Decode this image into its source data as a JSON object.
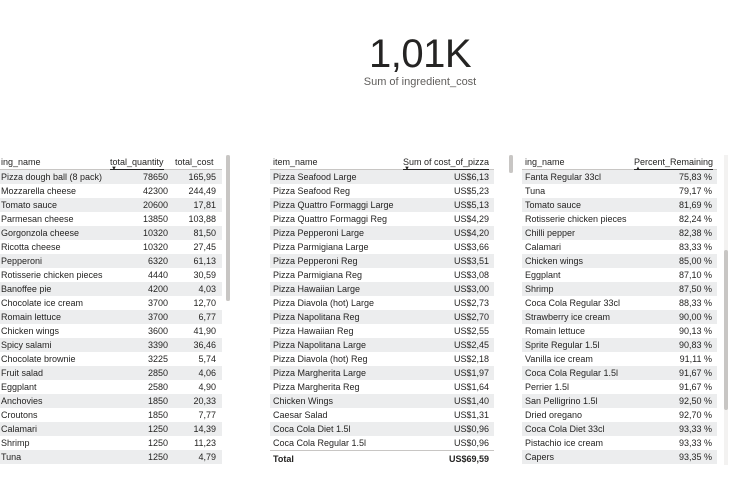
{
  "kpi": {
    "value": "1,01K",
    "label": "Sum of ingredient_cost"
  },
  "table1": {
    "headers": [
      "ing_name",
      "total_quantity",
      "total_cost"
    ],
    "rows": [
      [
        "Pizza dough ball (8 pack)",
        "78650",
        "165,95"
      ],
      [
        "Mozzarella cheese",
        "42300",
        "244,49"
      ],
      [
        "Tomato sauce",
        "20600",
        "17,81"
      ],
      [
        "Parmesan cheese",
        "13850",
        "103,88"
      ],
      [
        "Gorgonzola cheese",
        "10320",
        "81,50"
      ],
      [
        "Ricotta cheese",
        "10320",
        "27,45"
      ],
      [
        "Pepperoni",
        "6320",
        "61,13"
      ],
      [
        "Rotisserie chicken pieces",
        "4440",
        "30,59"
      ],
      [
        "Banoffee pie",
        "4200",
        "4,03"
      ],
      [
        "Chocolate ice cream",
        "3700",
        "12,70"
      ],
      [
        "Romain lettuce",
        "3700",
        "6,77"
      ],
      [
        "Chicken wings",
        "3600",
        "41,90"
      ],
      [
        "Spicy salami",
        "3390",
        "36,46"
      ],
      [
        "Chocolate brownie",
        "3225",
        "5,74"
      ],
      [
        "Fruit salad",
        "2850",
        "4,06"
      ],
      [
        "Eggplant",
        "2580",
        "4,90"
      ],
      [
        "Anchovies",
        "1850",
        "20,33"
      ],
      [
        "Croutons",
        "1850",
        "7,77"
      ],
      [
        "Calamari",
        "1250",
        "14,39"
      ],
      [
        "Shrimp",
        "1250",
        "11,23"
      ],
      [
        "Tuna",
        "1250",
        "4,79"
      ]
    ]
  },
  "table2": {
    "headers": [
      "item_name",
      "Sum of cost_of_pizza"
    ],
    "rows": [
      [
        "Pizza Seafood Large",
        "US$6,13"
      ],
      [
        "Pizza Seafood Reg",
        "US$5,23"
      ],
      [
        "Pizza Quattro Formaggi Large",
        "US$5,13"
      ],
      [
        "Pizza Quattro Formaggi Reg",
        "US$4,29"
      ],
      [
        "Pizza Pepperoni Large",
        "US$4,20"
      ],
      [
        "Pizza Parmigiana Large",
        "US$3,66"
      ],
      [
        "Pizza Pepperoni Reg",
        "US$3,51"
      ],
      [
        "Pizza Parmigiana Reg",
        "US$3,08"
      ],
      [
        "Pizza Hawaiian Large",
        "US$3,00"
      ],
      [
        "Pizza Diavola (hot) Large",
        "US$2,73"
      ],
      [
        "Pizza Napolitana Reg",
        "US$2,70"
      ],
      [
        "Pizza Hawaiian Reg",
        "US$2,55"
      ],
      [
        "Pizza Napolitana Large",
        "US$2,45"
      ],
      [
        "Pizza Diavola (hot) Reg",
        "US$2,18"
      ],
      [
        "Pizza Margherita Large",
        "US$1,97"
      ],
      [
        "Pizza Margherita Reg",
        "US$1,64"
      ],
      [
        "Chicken Wings",
        "US$1,40"
      ],
      [
        "Caesar Salad",
        "US$1,31"
      ],
      [
        "Coca Cola Diet 1.5l",
        "US$0,96"
      ],
      [
        "Coca Cola Regular 1.5l",
        "US$0,96"
      ]
    ],
    "total_label": "Total",
    "total_value": "US$69,59"
  },
  "table3": {
    "headers": [
      "ing_name",
      "Percent_Remaining"
    ],
    "rows": [
      [
        "Fanta Regular 33cl",
        "75,83 %"
      ],
      [
        "Tuna",
        "79,17 %"
      ],
      [
        "Tomato sauce",
        "81,69 %"
      ],
      [
        "Rotisserie chicken pieces",
        "82,24 %"
      ],
      [
        "Chilli pepper",
        "82,38 %"
      ],
      [
        "Calamari",
        "83,33 %"
      ],
      [
        "Chicken wings",
        "85,00 %"
      ],
      [
        "Eggplant",
        "87,10 %"
      ],
      [
        "Shrimp",
        "87,50 %"
      ],
      [
        "Coca Cola Regular 33cl",
        "88,33 %"
      ],
      [
        "Strawberry ice cream",
        "90,00 %"
      ],
      [
        "Romain lettuce",
        "90,13 %"
      ],
      [
        "Sprite Regular 1.5l",
        "90,83 %"
      ],
      [
        "Vanilla ice cream",
        "91,11 %"
      ],
      [
        "Coca Cola Regular 1.5l",
        "91,67 %"
      ],
      [
        "Perrier 1.5l",
        "91,67 %"
      ],
      [
        "San Pelligrino 1.5l",
        "92,50 %"
      ],
      [
        "Dried oregano",
        "92,70 %"
      ],
      [
        "Coca Cola Diet 33cl",
        "93,33 %"
      ],
      [
        "Pistachio ice cream",
        "93,33 %"
      ],
      [
        "Capers",
        "93,35 %"
      ]
    ]
  }
}
